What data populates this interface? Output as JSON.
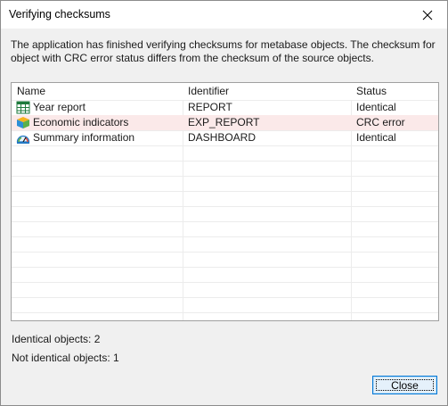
{
  "window": {
    "title": "Verifying checksums"
  },
  "message": "The application has finished verifying checksums for metabase objects. The checksum for object with CRC error status differs from the checksum of the source objects.",
  "table": {
    "columns": [
      "Name",
      "Identifier",
      "Status"
    ],
    "rows": [
      {
        "icon": "report-grid-icon",
        "name": "Year report",
        "identifier": "REPORT",
        "status": "Identical"
      },
      {
        "icon": "cube-icon",
        "name": "Economic indicators",
        "identifier": "EXP_REPORT",
        "status": "CRC error"
      },
      {
        "icon": "gauge-icon",
        "name": "Summary information",
        "identifier": "DASHBOARD",
        "status": "Identical"
      }
    ]
  },
  "summary": {
    "identical": "Identical objects: 2",
    "not_identical": "Not identical objects: 1"
  },
  "buttons": {
    "close": "Close"
  },
  "colors": {
    "accent": "#0078d7",
    "crc_error_row": "#fbe9e9"
  }
}
